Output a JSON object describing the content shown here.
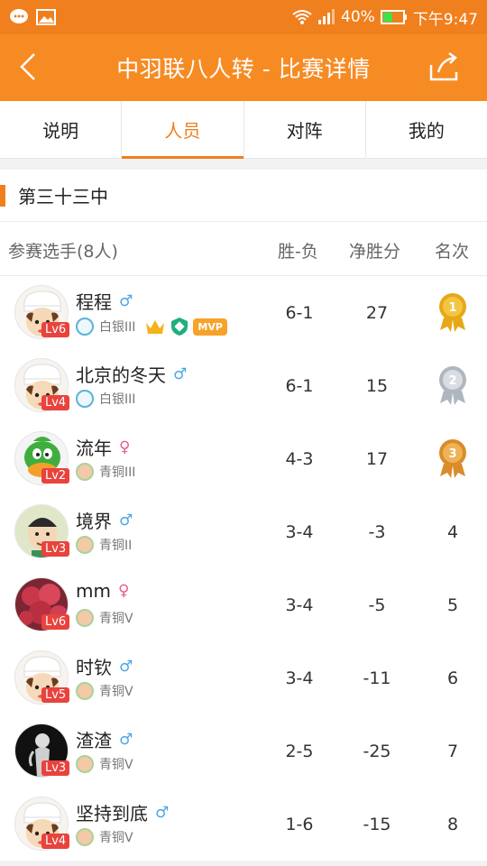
{
  "status_bar": {
    "battery": "40%",
    "time": "下午9:47"
  },
  "header": {
    "title": "中羽联八人转 - 比赛详情"
  },
  "tabs": [
    {
      "label": "说明",
      "active": false
    },
    {
      "label": "人员",
      "active": true
    },
    {
      "label": "对阵",
      "active": false
    },
    {
      "label": "我的",
      "active": false
    }
  ],
  "section": {
    "title": "第三十三中"
  },
  "table": {
    "headers": [
      "参赛选手(8人)",
      "胜-负",
      "净胜分",
      "名次"
    ],
    "rows": [
      {
        "name": "程程",
        "gender": "♂",
        "gender_type": "m",
        "level": "Lv6",
        "rank_title": "白银III",
        "rank_tier": "silver",
        "wl": "6-1",
        "net": "27",
        "place": "1",
        "medal": "gold",
        "avatar": "chef",
        "badges": [
          "crown-icon",
          "shield-badge-icon",
          "mvp"
        ],
        "mvp_label": "MVP"
      },
      {
        "name": "北京的冬天",
        "gender": "♂",
        "gender_type": "m",
        "level": "Lv4",
        "rank_title": "白银III",
        "rank_tier": "silver",
        "wl": "6-1",
        "net": "15",
        "place": "2",
        "medal": "silver",
        "avatar": "chef"
      },
      {
        "name": "流年",
        "gender": "♀",
        "gender_type": "f",
        "level": "Lv2",
        "rank_title": "青铜III",
        "rank_tier": "bronze",
        "wl": "4-3",
        "net": "17",
        "place": "3",
        "medal": "bronze",
        "avatar": "duck"
      },
      {
        "name": "境界",
        "gender": "♂",
        "gender_type": "m",
        "level": "Lv3",
        "rank_title": "青铜II",
        "rank_tier": "bronze",
        "wl": "3-4",
        "net": "-3",
        "place": "4",
        "avatar": "cartoon"
      },
      {
        "name": "mm",
        "gender": "♀",
        "gender_type": "f",
        "level": "Lv6",
        "rank_title": "青铜V",
        "rank_tier": "bronze",
        "wl": "3-4",
        "net": "-5",
        "place": "5",
        "avatar": "fruit"
      },
      {
        "name": "时钦",
        "gender": "♂",
        "gender_type": "m",
        "level": "Lv5",
        "rank_title": "青铜V",
        "rank_tier": "bronze",
        "wl": "3-4",
        "net": "-11",
        "place": "6",
        "avatar": "chef"
      },
      {
        "name": "渣渣",
        "gender": "♂",
        "gender_type": "m",
        "level": "Lv3",
        "rank_title": "青铜V",
        "rank_tier": "bronze",
        "wl": "2-5",
        "net": "-25",
        "place": "7",
        "avatar": "dark"
      },
      {
        "name": "坚持到底",
        "gender": "♂",
        "gender_type": "m",
        "level": "Lv4",
        "rank_title": "青铜V",
        "rank_tier": "bronze",
        "wl": "1-6",
        "net": "-15",
        "place": "8",
        "avatar": "chef"
      }
    ]
  },
  "colors": {
    "primary": "#f68b24",
    "gender_male": "#4aa6e8",
    "gender_female": "#ec5a91",
    "level_badge": "#e8433d"
  }
}
